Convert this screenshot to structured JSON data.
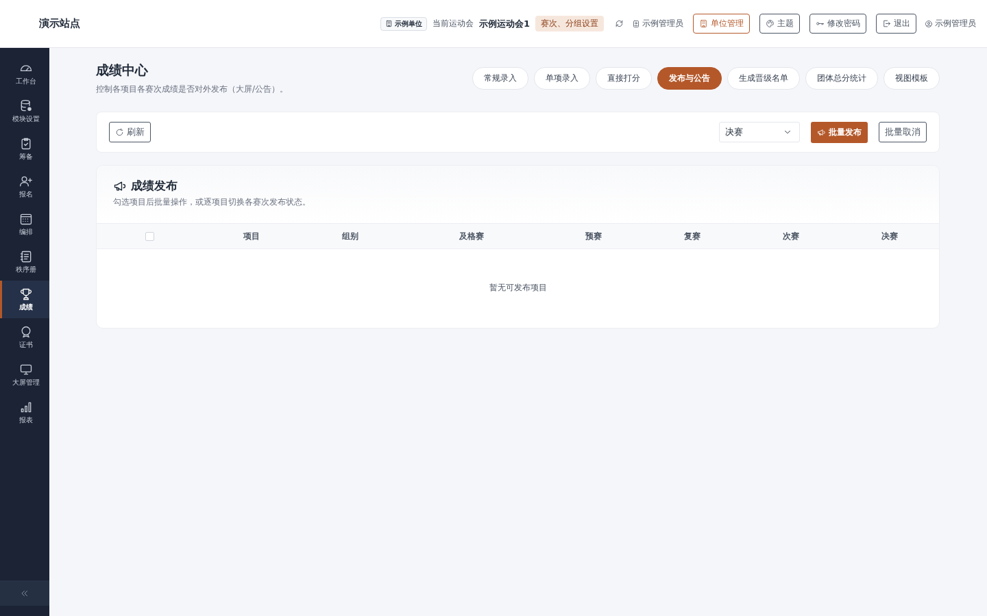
{
  "header": {
    "site_title": "演示站点",
    "unit_badge": "示例单位",
    "meet_label": "当前运动会",
    "meet_name": "示例运动会1",
    "meet_tag": "赛次、分组设置",
    "admin_label": "示例管理员",
    "actions": [
      {
        "label": "单位管理",
        "kind": "primary"
      },
      {
        "label": "主题",
        "kind": "default"
      },
      {
        "label": "修改密码",
        "kind": "default"
      },
      {
        "label": "退出",
        "kind": "default"
      }
    ],
    "user_name": "示例管理员"
  },
  "sidebar": {
    "items": [
      {
        "label": "工作台",
        "selected": false
      },
      {
        "label": "模块设置",
        "selected": false
      },
      {
        "label": "筹备",
        "selected": false
      },
      {
        "label": "报名",
        "selected": false
      },
      {
        "label": "编排",
        "selected": false
      },
      {
        "label": "秩序册",
        "selected": false
      },
      {
        "label": "成绩",
        "selected": true
      },
      {
        "label": "证书",
        "selected": false
      },
      {
        "label": "大屏管理",
        "selected": false
      },
      {
        "label": "报表",
        "selected": false
      }
    ]
  },
  "page": {
    "title": "成绩中心",
    "subtitle": "控制各项目各赛次成绩是否对外发布（大屏/公告）。",
    "tabs": [
      {
        "label": "常规录入",
        "selected": false
      },
      {
        "label": "单项录入",
        "selected": false
      },
      {
        "label": "直接打分",
        "selected": false
      },
      {
        "label": "发布与公告",
        "selected": true
      },
      {
        "label": "生成晋级名单",
        "selected": false
      },
      {
        "label": "团体总分统计",
        "selected": false
      },
      {
        "label": "视图模板",
        "selected": false
      }
    ]
  },
  "toolbar": {
    "refresh_label": "刷新",
    "round_select": {
      "value": "决赛"
    },
    "publish_label": "批量发布",
    "cancel_label": "批量取消"
  },
  "panel": {
    "title": "成绩发布",
    "description": "勾选项目后批量操作，或逐项目切换各赛次发布状态。",
    "table": {
      "select_all": {
        "checked": false
      },
      "columns": [
        "项目",
        "组别",
        "及格赛",
        "预赛",
        "复赛",
        "次赛",
        "决赛"
      ],
      "empty_text": "暂无可发布项目"
    }
  }
}
